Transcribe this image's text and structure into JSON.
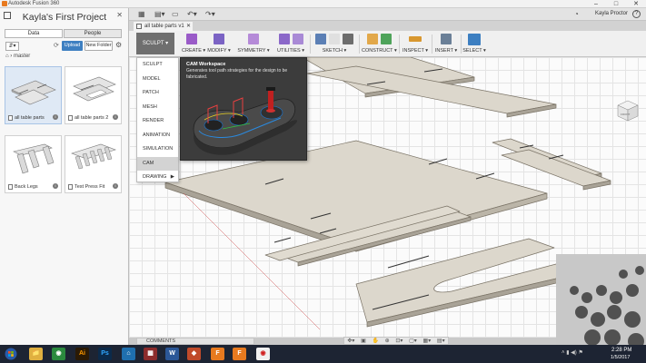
{
  "window": {
    "title": "Autodesk Fusion 360",
    "controls": [
      "–",
      "□",
      "✕"
    ]
  },
  "data_panel": {
    "project_title": "Kayla's First Project",
    "tabs": [
      {
        "label": "Data"
      },
      {
        "label": "People"
      }
    ],
    "upload_label": "Upload",
    "new_folder_label": "New Folder",
    "breadcrumb": "master",
    "files": [
      {
        "name": "all table parts",
        "selected": true
      },
      {
        "name": "all table parts 2",
        "selected": false
      },
      {
        "name": "Back Legs",
        "selected": false
      },
      {
        "name": "Test Press Fit",
        "selected": false
      }
    ]
  },
  "header": {
    "user": "Kayla Proctor",
    "help": "?"
  },
  "document_tab": {
    "label": "all table parts v1"
  },
  "ribbon": {
    "workspace_label": "SCULPT ▾",
    "groups": [
      {
        "label": "CREATE ▾",
        "colors": [
          "#9a5bc8"
        ]
      },
      {
        "label": "MODIFY ▾",
        "colors": [
          "#7b63c4"
        ]
      },
      {
        "label": "SYMMETRY ▾",
        "colors": [
          "#b58ad8"
        ]
      },
      {
        "label": "UTILITIES ▾",
        "colors": [
          "#8b68c9",
          "#a98ad6"
        ]
      },
      {
        "label": "SKETCH ▾",
        "colors": [
          "#5b7fb5",
          "#e0e0e0",
          "#6d6d6d"
        ]
      },
      {
        "label": "CONSTRUCT ▾",
        "colors": [
          "#e2a84a",
          "#4ea35a"
        ]
      },
      {
        "label": "INSPECT ▾",
        "colors": [
          "#d8972f"
        ]
      },
      {
        "label": "INSERT ▾",
        "colors": [
          "#6a7f97"
        ]
      },
      {
        "label": "SELECT ▾",
        "colors": [
          "#3d7fc1"
        ]
      }
    ]
  },
  "workspace_menu": {
    "items": [
      {
        "label": "SCULPT",
        "active": false,
        "submenu": false
      },
      {
        "label": "MODEL",
        "active": false,
        "submenu": false
      },
      {
        "label": "PATCH",
        "active": false,
        "submenu": false
      },
      {
        "label": "MESH",
        "active": false,
        "submenu": false
      },
      {
        "label": "RENDER",
        "active": false,
        "submenu": false
      },
      {
        "label": "ANIMATION",
        "active": false,
        "submenu": false
      },
      {
        "label": "SIMULATION",
        "active": false,
        "submenu": false
      },
      {
        "label": "CAM",
        "active": true,
        "submenu": false
      },
      {
        "label": "DRAWING",
        "active": false,
        "submenu": true
      }
    ],
    "submenu_arrow": "▶"
  },
  "tooltip": {
    "title": "CAM Workspace",
    "description": "Generates tool path strategies for the design to be fabricated."
  },
  "view_cube": {
    "face": "FRONT"
  },
  "comments_label": "COMMENTS",
  "taskbar": {
    "apps": [
      {
        "glyph": "📁",
        "color": "#e0b040"
      },
      {
        "glyph": "◉",
        "color": "#2b8a3e"
      },
      {
        "glyph": "Ai",
        "color": "#2a1a05"
      },
      {
        "glyph": "Ps",
        "color": "#0b2a4a"
      },
      {
        "glyph": "⌂",
        "color": "#1f6fae"
      },
      {
        "glyph": "▦",
        "color": "#8c2c2c"
      },
      {
        "glyph": "W",
        "color": "#2b5797"
      },
      {
        "glyph": "◆",
        "color": "#c04a2a"
      },
      {
        "glyph": "F",
        "color": "#e87a1f"
      },
      {
        "glyph": "F",
        "color": "#e87a1f"
      },
      {
        "glyph": "◉",
        "color": "#f0f0f0"
      }
    ],
    "time": "2:28 PM",
    "date": "1/5/2017"
  }
}
